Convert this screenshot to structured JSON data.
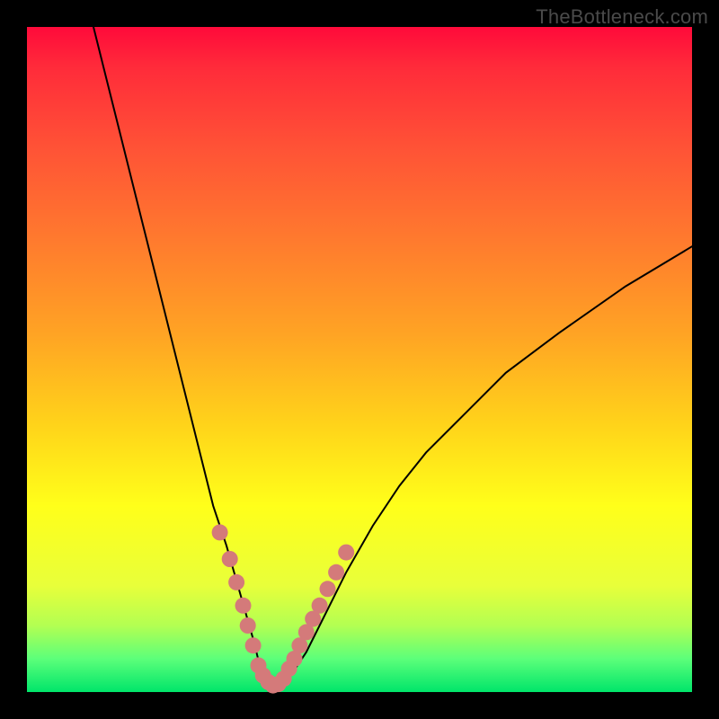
{
  "watermark": "TheBottleneck.com",
  "chart_data": {
    "type": "line",
    "title": "",
    "xlabel": "",
    "ylabel": "",
    "xlim": [
      0,
      100
    ],
    "ylim": [
      0,
      100
    ],
    "grid": false,
    "series": [
      {
        "name": "bottleneck-curve",
        "stroke": "#000000",
        "x": [
          10,
          12,
          14,
          16,
          18,
          20,
          22,
          24,
          26,
          28,
          30,
          32,
          34,
          35,
          36,
          37,
          38,
          40,
          42,
          44,
          46,
          48,
          52,
          56,
          60,
          66,
          72,
          80,
          90,
          100
        ],
        "y": [
          100,
          92,
          84,
          76,
          68,
          60,
          52,
          44,
          36,
          28,
          22,
          15,
          8,
          4,
          2,
          1,
          1.5,
          3,
          6,
          10,
          14,
          18,
          25,
          31,
          36,
          42,
          48,
          54,
          61,
          67
        ]
      }
    ],
    "markers": {
      "name": "highlight-dots",
      "color": "#d47a7a",
      "radius_px": 9,
      "points": [
        {
          "x": 29,
          "y": 24
        },
        {
          "x": 30.5,
          "y": 20
        },
        {
          "x": 31.5,
          "y": 16.5
        },
        {
          "x": 32.5,
          "y": 13
        },
        {
          "x": 33.2,
          "y": 10
        },
        {
          "x": 34,
          "y": 7
        },
        {
          "x": 34.8,
          "y": 4
        },
        {
          "x": 35.5,
          "y": 2.5
        },
        {
          "x": 36.3,
          "y": 1.5
        },
        {
          "x": 37,
          "y": 1
        },
        {
          "x": 37.8,
          "y": 1.2
        },
        {
          "x": 38.6,
          "y": 2
        },
        {
          "x": 39.4,
          "y": 3.5
        },
        {
          "x": 40.2,
          "y": 5
        },
        {
          "x": 41,
          "y": 7
        },
        {
          "x": 42,
          "y": 9
        },
        {
          "x": 43,
          "y": 11
        },
        {
          "x": 44,
          "y": 13
        },
        {
          "x": 45.2,
          "y": 15.5
        },
        {
          "x": 46.5,
          "y": 18
        },
        {
          "x": 48,
          "y": 21
        }
      ]
    }
  }
}
